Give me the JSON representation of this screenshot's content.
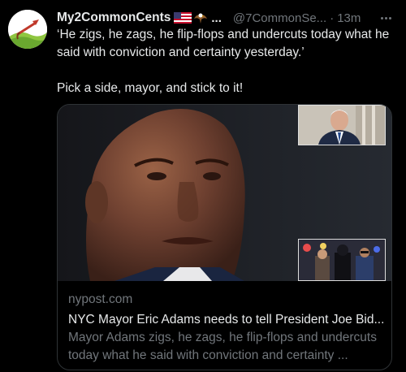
{
  "author": {
    "name": "My2CommonCents",
    "name_suffix": "...",
    "handle": "@7CommonSe...",
    "separator": "·",
    "time": "13m",
    "flag_icons": [
      "us-flag-icon",
      "eagle-icon"
    ]
  },
  "tweet": {
    "paragraphs": [
      "‘He zigs, he zags, he flip-flops and undercuts today what he said with conviction and certainty yesterday.’",
      "Pick a side, mayor, and stick to it!"
    ]
  },
  "card": {
    "domain": "nypost.com",
    "title": "NYC Mayor Eric Adams needs to tell President Joe Bid...",
    "description_line1": "Mayor Adams zigs, he zags, he flip-flops and undercuts",
    "description_line2": "today what he said with conviction and certainty ..."
  },
  "colors": {
    "background": "#000000",
    "text_primary": "#e7e9ea",
    "text_secondary": "#71767b",
    "border": "#2f3336"
  }
}
